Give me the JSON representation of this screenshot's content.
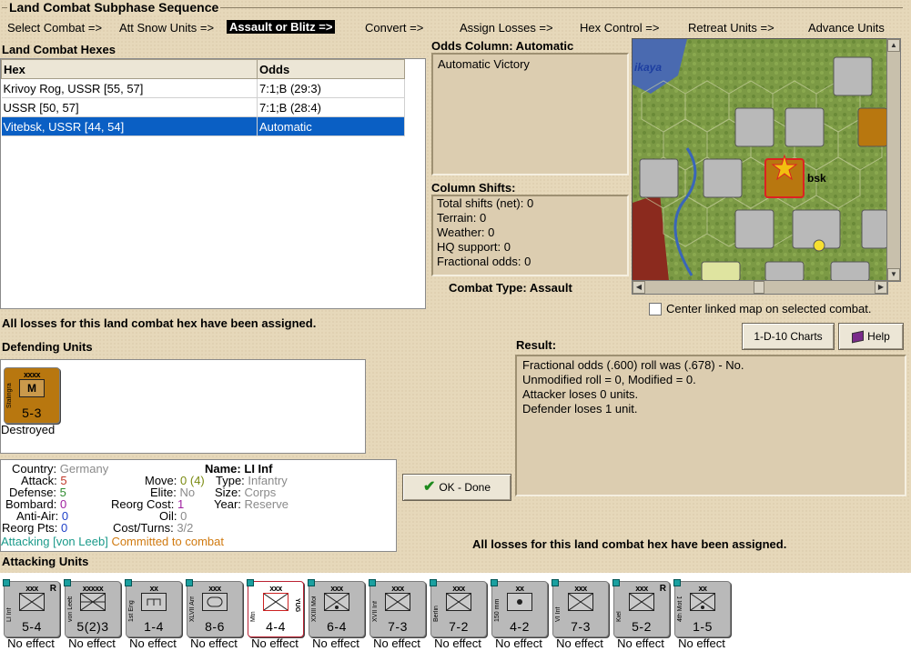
{
  "subphase": {
    "title": "Land Combat Subphase Sequence",
    "steps": [
      {
        "label": "Select Combat =>"
      },
      {
        "label": "Att Snow Units =>"
      },
      {
        "label": "Assault or Blitz =>"
      },
      {
        "label": "Convert =>"
      },
      {
        "label": "Assign Losses =>"
      },
      {
        "label": "Hex Control =>"
      },
      {
        "label": "Retreat Units =>"
      },
      {
        "label": "Advance Units"
      }
    ],
    "active_step": "Assault or Blitz =>"
  },
  "hexes": {
    "label": "Land Combat Hexes",
    "columns": [
      "Hex",
      "Odds"
    ],
    "rows": [
      {
        "hex": "Krivoy Rog, USSR [55, 57]",
        "odds": "7:1;B (29:3)"
      },
      {
        "hex": "USSR [50, 57]",
        "odds": "7:1;B (28:4)"
      },
      {
        "hex": "Vitebsk, USSR [44, 54]",
        "odds": "Automatic",
        "selected": true
      }
    ]
  },
  "odds": {
    "label": "Odds Column: Automatic",
    "text": "Automatic Victory"
  },
  "shifts": {
    "label": "Column Shifts:",
    "lines": [
      "Total shifts (net): 0",
      "Terrain: 0",
      "Weather: 0",
      "HQ support: 0",
      "Fractional odds: 0"
    ]
  },
  "combat_type": "Combat Type:  Assault",
  "map": {
    "center_label": "Center linked map on selected combat.",
    "place_labels": [
      "ikaya",
      "bsk"
    ]
  },
  "buttons": {
    "charts": "1-D-10 Charts",
    "help": "Help",
    "ok": "OK - Done"
  },
  "losses_msg": "All losses for this land combat hex have been assigned.",
  "defending": {
    "label": "Defending Units",
    "unit": {
      "size": "xxxx",
      "name": "Stalingrad",
      "strength": "5-3",
      "status": "Destroyed",
      "color": "#b8770f"
    }
  },
  "result": {
    "label": "Result:",
    "lines": [
      "Fractional odds (.600) roll was (.678)  - No.",
      "Unmodified roll = 0, Modified = 0.",
      "Attacker loses 0 units.",
      "Defender loses 1 unit."
    ]
  },
  "details": {
    "country_lbl": "Country:",
    "country": "Germany",
    "attack_lbl": "Attack:",
    "attack": "5",
    "defense_lbl": "Defense:",
    "defense": "5",
    "bombard_lbl": "Bombard:",
    "bombard": "0",
    "antiair_lbl": "Anti-Air:",
    "antiair": "0",
    "reorg_pts_lbl": "Reorg Pts:",
    "reorg_pts": "0",
    "move_lbl": "Move:",
    "move": "0 (4)",
    "elite_lbl": "Elite:",
    "elite": "No",
    "reorg_cost_lbl": "Reorg Cost:",
    "reorg_cost": "1",
    "oil_lbl": "Oil:",
    "oil": "0",
    "cost_lbl": "Cost/Turns:",
    "cost": "3/2",
    "name_lbl": "Name:",
    "name": "LI Inf",
    "type_lbl": "Type:",
    "type": "Infantry",
    "unit_size_lbl": "Size:",
    "unit_size": "Corps",
    "year_lbl": "Year:",
    "year": "Reserve",
    "attacking_note": "Attacking [von Leeb]",
    "committed_note": "Committed to combat"
  },
  "attacking": {
    "label": "Attacking Units",
    "units": [
      {
        "name": "LI Inf",
        "size": "xxx",
        "strength": "5-4",
        "type": "inf",
        "r": "R",
        "result": "No effect"
      },
      {
        "name": "von Leeb",
        "size": "xxxxx",
        "strength": "5(2)3",
        "type": "hq",
        "r": "",
        "result": "No effect"
      },
      {
        "name": "1st Eng",
        "size": "xx",
        "strength": "1-4",
        "type": "eng",
        "r": "",
        "result": "No effect"
      },
      {
        "name": "XLVII Arm",
        "size": "xxx",
        "strength": "8-6",
        "type": "arm",
        "r": "",
        "result": "No effect"
      },
      {
        "name": "Mtn",
        "size": "xxx",
        "strength": "4-4",
        "type": "mtn",
        "r": "YUG",
        "result": "No effect",
        "selected": true
      },
      {
        "name": "XXIII Mot",
        "size": "xxx",
        "strength": "6-4",
        "type": "mot",
        "r": "",
        "result": "No effect"
      },
      {
        "name": "XVII Inf",
        "size": "xxx",
        "strength": "7-3",
        "type": "inf",
        "r": "",
        "result": "No effect"
      },
      {
        "name": "Berlin",
        "size": "xxx",
        "strength": "7-2",
        "type": "mil",
        "r": "",
        "result": "No effect"
      },
      {
        "name": "150 mm",
        "size": "xx",
        "strength": "4-2",
        "type": "art",
        "r": "",
        "result": "No effect"
      },
      {
        "name": "VI Inf",
        "size": "xxx",
        "strength": "7-3",
        "type": "inf",
        "r": "",
        "result": "No effect"
      },
      {
        "name": "Kiel",
        "size": "xxx",
        "strength": "5-2",
        "type": "mil",
        "r": "R",
        "result": "No effect"
      },
      {
        "name": "4th Mot Div",
        "size": "xx",
        "strength": "1-5",
        "type": "mot",
        "r": "",
        "result": "No effect"
      }
    ]
  },
  "colors": {
    "selection": "#0a5fc4",
    "attack": "#c0392b",
    "defense": "#2e8b2e",
    "bombard": "#a020a0",
    "antiair": "#1e40c8",
    "attacking_note": "#1a9a8a",
    "committed_note": "#d07a10",
    "stalingrad": "#b8770f"
  }
}
